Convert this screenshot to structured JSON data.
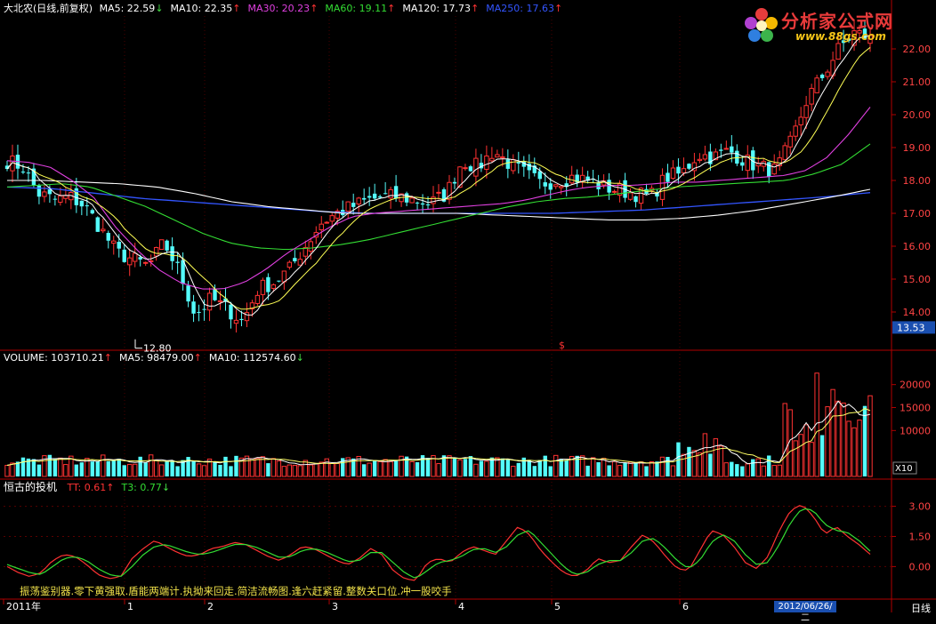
{
  "main_header": {
    "name": "大北农(日线,前复权)",
    "items": [
      {
        "label": "MA5: 22.59",
        "arrow": "↓",
        "color": "#ffffff",
        "arrow_color": "#44dd44"
      },
      {
        "label": "MA10: 22.35",
        "arrow": "↑",
        "color": "#ffffff",
        "arrow_color": "#ff3333"
      },
      {
        "label": "MA30: 20.23",
        "arrow": "↑",
        "color": "#e040e0",
        "arrow_color": "#ff3333"
      },
      {
        "label": "MA60: 19.11",
        "arrow": "↑",
        "color": "#33dd33",
        "arrow_color": "#ff3333"
      },
      {
        "label": "MA120: 17.73",
        "arrow": "↑",
        "color": "#ffffff",
        "arrow_color": "#ff3333"
      },
      {
        "label": "MA250: 17.63",
        "arrow": "↑",
        "color": "#3355ff",
        "arrow_color": "#ff3333"
      }
    ]
  },
  "volume_header": {
    "items": [
      {
        "label": "VOLUME: 103710.21",
        "arrow": "↑",
        "color": "#ffffff",
        "arrow_color": "#ff3333"
      },
      {
        "label": "MA5: 98479.00",
        "arrow": "↑",
        "color": "#ffffff",
        "arrow_color": "#ff3333"
      },
      {
        "label": "MA10: 112574.60",
        "arrow": "↓",
        "color": "#ffffff",
        "arrow_color": "#44dd44"
      }
    ]
  },
  "indicator_header": {
    "name": "恒古的投机",
    "items": [
      {
        "label": "TT: 0.61",
        "arrow": "↑",
        "color": "#ff3333",
        "arrow_color": "#ff3333"
      },
      {
        "label": "T3: 0.77",
        "arrow": "↓",
        "color": "#33dd33",
        "arrow_color": "#44dd44"
      }
    ]
  },
  "logo": {
    "title": "分析家公式网",
    "url": "www.88gs.com"
  },
  "bottom_note": "振荡鉴别器.零下黄强取.盾能两端计.执拗来回走.简洁流畅图.逢六赶紧留.整数关口位.冲一股咬手",
  "date_box": "2012/06/26/二",
  "period": "日线",
  "colors": {
    "up": "#ff3232",
    "down": "#54fcfc",
    "ma5": "#ffffff",
    "ma10": "#ffff55",
    "ma30": "#e040e0",
    "ma60": "#33dd33",
    "ma120": "#ffffff",
    "ma250": "#3355ff",
    "grid": "#7a0000",
    "axis": "#b00000"
  },
  "chart_data": [
    {
      "type": "candlestick",
      "panel": "price",
      "y_ticks": [
        "14.00",
        "15.00",
        "16.00",
        "17.00",
        "18.00",
        "19.00",
        "20.00",
        "21.00",
        "22.00"
      ],
      "ylim": [
        13.0,
        23.0
      ],
      "current_price_label": "13.53",
      "low_annotation": "12.80",
      "marker": "$",
      "x_labels": [
        "2011年",
        "1",
        "2",
        "3",
        "4",
        "5",
        "6"
      ],
      "close_path": [
        18.6,
        18.4,
        17.6,
        17.4,
        17.5,
        17.2,
        16.5,
        15.8,
        15.6,
        15.4,
        16.1,
        15.2,
        13.9,
        14.4,
        14.1,
        13.7,
        14.7,
        14.9,
        15.3,
        16.0,
        16.7,
        17.0,
        17.2,
        17.4,
        17.5,
        17.5,
        17.4,
        17.3,
        17.6,
        18.6,
        18.4,
        18.9,
        18.5,
        18.2,
        17.9,
        18.0,
        18.1,
        18.0,
        17.8,
        17.7,
        17.6,
        17.5,
        18.1,
        18.2,
        18.8,
        18.7,
        18.9,
        18.6,
        18.4,
        18.3,
        19.2,
        20.5,
        21.2,
        22.0,
        22.5,
        22.3
      ],
      "ma30_path": [
        18.6,
        18.55,
        18.4,
        18.0,
        17.5,
        16.6,
        15.9,
        15.3,
        14.9,
        14.7,
        14.7,
        14.9,
        15.3,
        15.8,
        16.2,
        16.6,
        16.9,
        17.0,
        17.05,
        17.1,
        17.15,
        17.2,
        17.25,
        17.3,
        17.4,
        17.55,
        17.7,
        17.8,
        17.85,
        17.85,
        17.9,
        17.95,
        17.95,
        18.0,
        18.05,
        18.1,
        18.15,
        18.3,
        18.7,
        19.4,
        20.23
      ],
      "ma60_path": [
        17.8,
        17.85,
        17.9,
        17.8,
        17.5,
        17.2,
        16.8,
        16.4,
        16.1,
        15.95,
        15.9,
        15.95,
        16.05,
        16.2,
        16.4,
        16.6,
        16.8,
        17.0,
        17.2,
        17.35,
        17.45,
        17.5,
        17.6,
        17.7,
        17.8,
        17.85,
        17.9,
        17.95,
        18.0,
        18.2,
        18.5,
        19.11
      ],
      "ma120_path": [
        18.0,
        18.0,
        17.95,
        17.9,
        17.8,
        17.6,
        17.35,
        17.2,
        17.1,
        17.0,
        17.0,
        17.0,
        17.0,
        16.95,
        16.9,
        16.85,
        16.8,
        16.8,
        16.85,
        16.95,
        17.1,
        17.3,
        17.5,
        17.73
      ],
      "ma250_path": [
        17.8,
        17.75,
        17.6,
        17.45,
        17.35,
        17.25,
        17.15,
        17.05,
        17.0,
        17.0,
        17.0,
        17.0,
        17.0,
        17.05,
        17.1,
        17.2,
        17.3,
        17.4,
        17.5,
        17.63
      ]
    },
    {
      "type": "bar",
      "panel": "volume",
      "y_ticks": [
        "10000",
        "15000",
        "20000"
      ],
      "unit_label": "X10",
      "ylim": [
        0,
        24000
      ]
    },
    {
      "type": "line",
      "panel": "indicator",
      "y_ticks": [
        "0.00",
        "1.50",
        "3.00"
      ],
      "ylim": [
        -1.0,
        3.6
      ],
      "series": [
        {
          "name": "TT",
          "values": [
            0.0,
            -0.3,
            -0.5,
            -0.3,
            0.3,
            0.6,
            0.5,
            0.1,
            -0.4,
            -0.6,
            -0.5,
            0.4,
            0.9,
            1.3,
            1.0,
            0.7,
            0.5,
            0.6,
            0.9,
            1.0,
            1.2,
            1.1,
            0.8,
            0.5,
            0.3,
            0.6,
            1.0,
            0.9,
            0.6,
            0.3,
            0.1,
            0.4,
            0.9,
            0.6,
            -0.2,
            -0.6,
            -0.7,
            0.2,
            0.4,
            0.2,
            0.7,
            1.0,
            0.8,
            0.6,
            1.3,
            2.0,
            1.6,
            0.8,
            0.2,
            -0.3,
            -0.5,
            -0.2,
            0.4,
            0.2,
            0.3,
            1.0,
            1.6,
            1.2,
            0.5,
            -0.1,
            -0.2,
            0.8,
            1.8,
            1.6,
            1.0,
            0.2,
            -0.1,
            0.5,
            1.8,
            2.8,
            3.1,
            2.5,
            1.6,
            2.0,
            1.5,
            1.1,
            0.61
          ]
        },
        {
          "name": "T3",
          "values": [
            0.1,
            -0.1,
            -0.3,
            -0.4,
            0.0,
            0.4,
            0.5,
            0.3,
            -0.1,
            -0.4,
            -0.5,
            0.0,
            0.6,
            1.0,
            1.1,
            0.9,
            0.7,
            0.6,
            0.7,
            0.9,
            1.1,
            1.1,
            0.95,
            0.7,
            0.45,
            0.5,
            0.8,
            0.9,
            0.75,
            0.5,
            0.25,
            0.3,
            0.7,
            0.7,
            0.2,
            -0.3,
            -0.6,
            -0.2,
            0.2,
            0.3,
            0.5,
            0.85,
            0.9,
            0.7,
            1.0,
            1.6,
            1.8,
            1.2,
            0.6,
            0.0,
            -0.4,
            -0.3,
            0.1,
            0.3,
            0.3,
            0.7,
            1.3,
            1.4,
            0.9,
            0.3,
            -0.1,
            0.3,
            1.2,
            1.6,
            1.3,
            0.6,
            0.1,
            0.2,
            1.1,
            2.2,
            2.9,
            2.8,
            2.1,
            1.8,
            1.7,
            1.3,
            0.77
          ]
        }
      ]
    }
  ]
}
